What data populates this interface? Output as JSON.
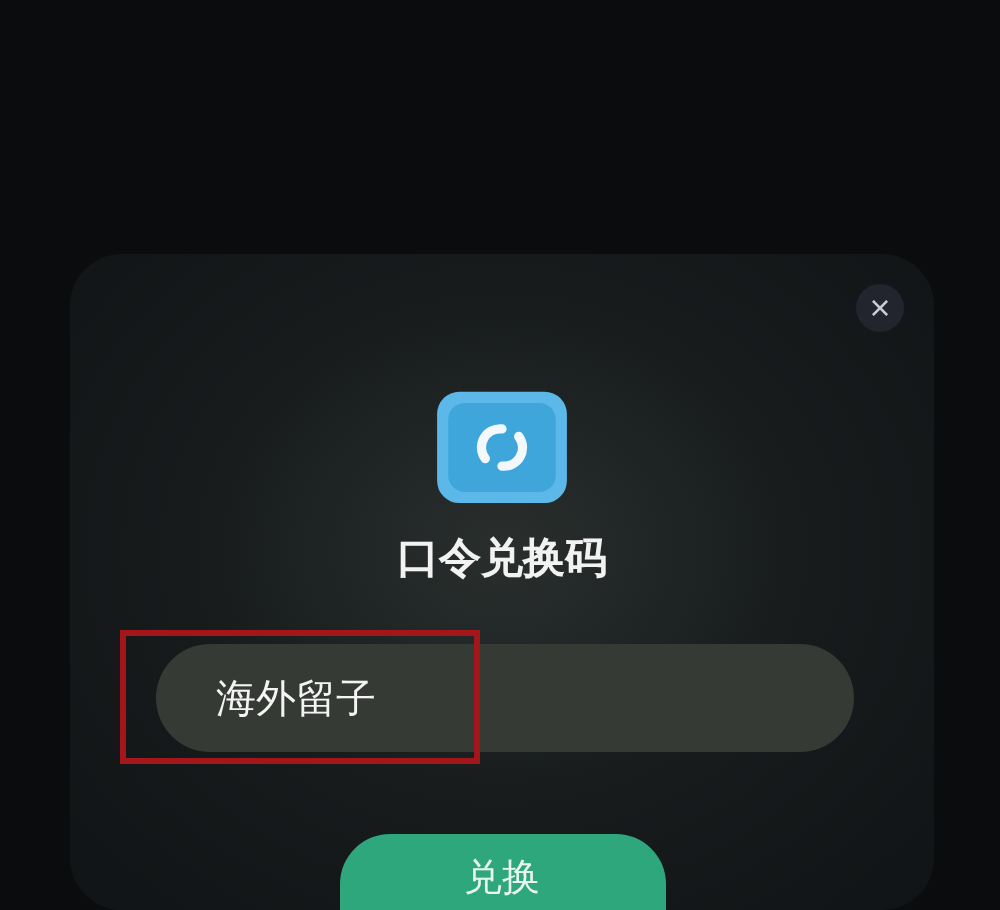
{
  "dialog": {
    "close_label": "×",
    "title": "口令兑换码",
    "code_field": {
      "value": "海外留子",
      "highlighted": true
    },
    "submit_button": {
      "label": "兑换"
    }
  }
}
